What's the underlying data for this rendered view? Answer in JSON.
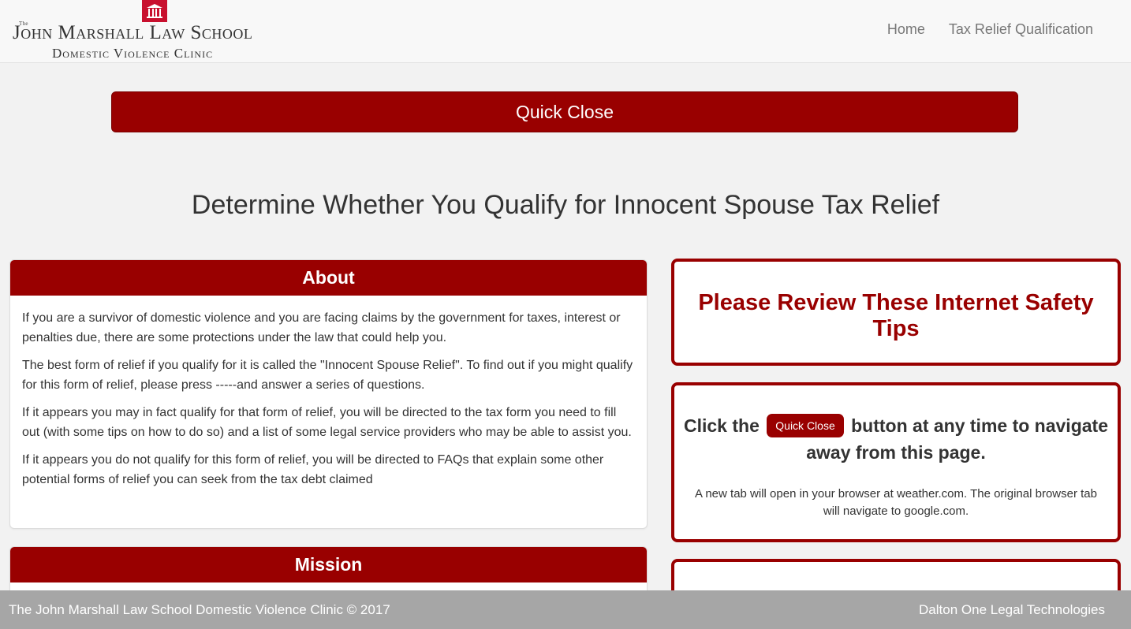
{
  "brand": {
    "emblem_text": "The",
    "title": "John Marshall Law School",
    "subtitle": "Domestic Violence Clinic",
    "accent_color": "#c8102e"
  },
  "nav": {
    "home": "Home",
    "tax_relief": "Tax Relief Qualification"
  },
  "quick_close": {
    "label": "Quick Close",
    "color": "#990000"
  },
  "page_title": "Determine Whether You Qualify for Innocent Spouse Tax Relief",
  "about": {
    "heading": "About",
    "paragraphs": [
      "If you are a survivor of domestic violence and you are facing claims by the government for taxes, interest or penalties due, there are some protections under the law that could help you.",
      "The best form of relief if you qualify for it is called the \"Innocent Spouse Relief\". To find out if you might qualify for this form of relief, please press -----and answer a series of questions.",
      "If it appears you may in fact qualify for that form of relief, you will be directed to the tax form you need to fill out (with some tips on how to do so) and a list of some legal service providers who may be able to assist you.",
      "If it appears you do not qualify for this form of relief, you will be directed to FAQs that explain some other potential forms of relief you can seek from the tax debt claimed"
    ]
  },
  "mission": {
    "heading": "Mission"
  },
  "safety": {
    "title": "Please Review These Internet Safety Tips",
    "click_before": "Click the",
    "button_label": "Quick Close",
    "click_after": "button at any time to navigate away from this page.",
    "note": "A new tab will open in your browser at weather.com. The original browser tab will navigate to google.com."
  },
  "footer": {
    "left": "The John Marshall Law School Domestic Violence Clinic © 2017",
    "right": "Dalton One Legal Technologies"
  }
}
